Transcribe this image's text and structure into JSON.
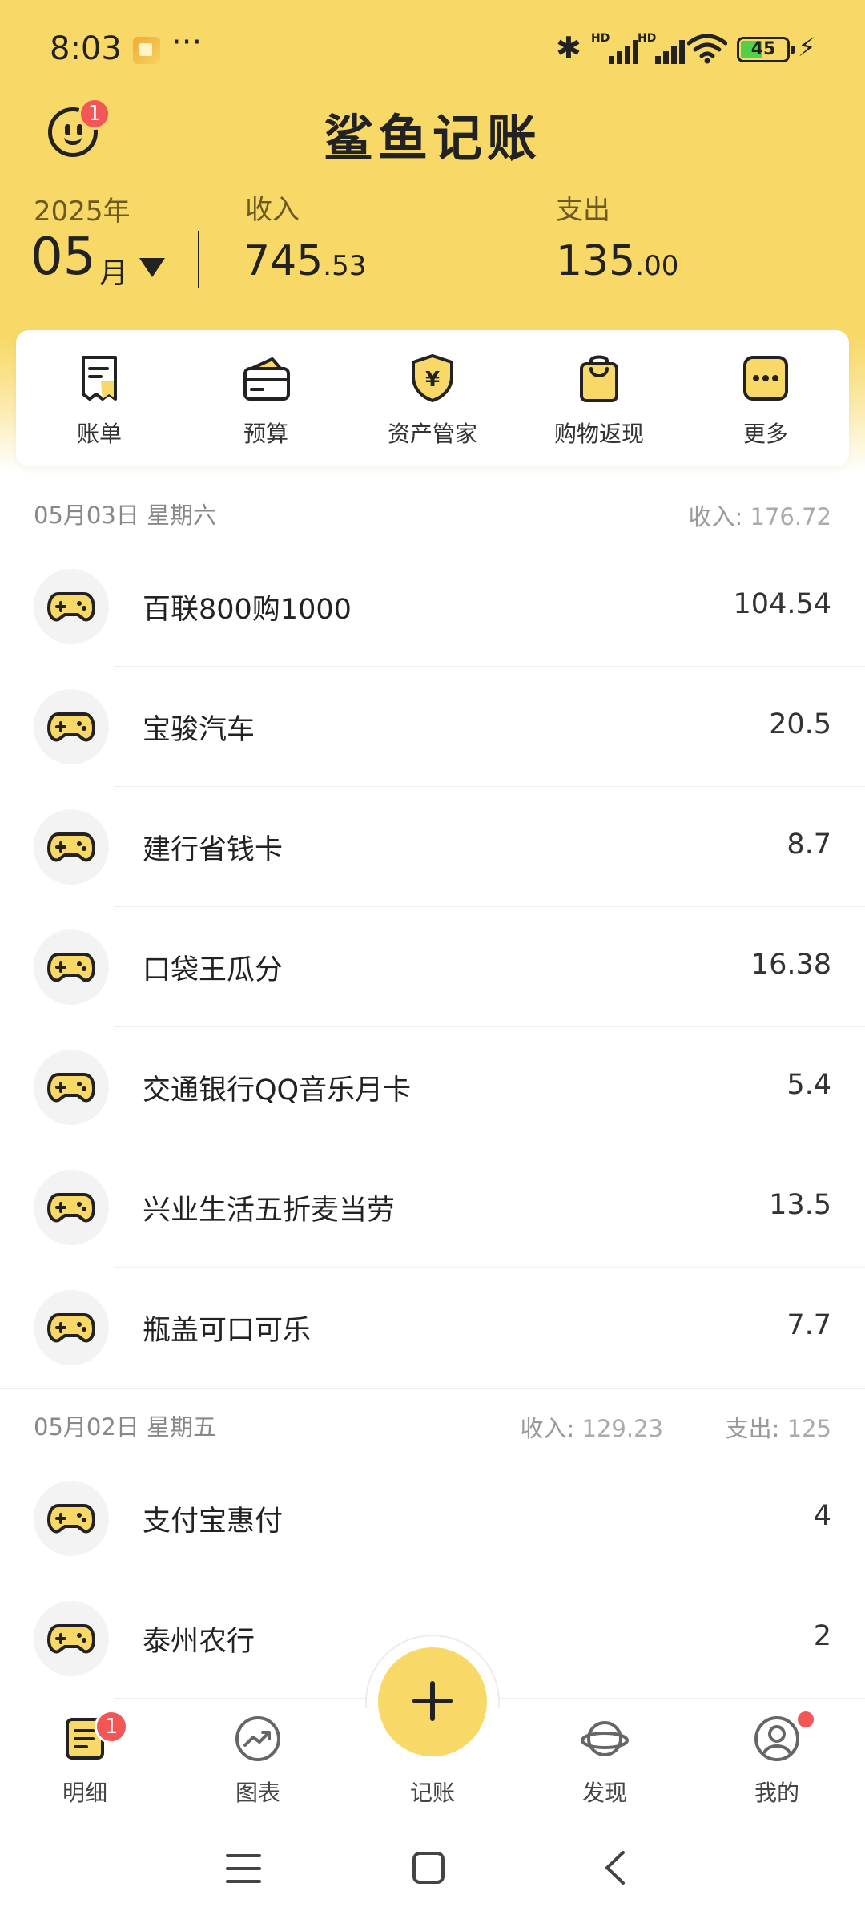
{
  "status_bar": {
    "time": "8:03",
    "more": "···",
    "battery": "45"
  },
  "header": {
    "title": "鲨鱼记账",
    "notification_count": "1",
    "year": "2025年",
    "month": "05",
    "month_unit": "月",
    "income_label": "收入",
    "income_int": "745",
    "income_dec": ".53",
    "expense_label": "支出",
    "expense_int": "135",
    "expense_dec": ".00"
  },
  "quick_menu": [
    {
      "label": "账单",
      "icon": "bill-icon"
    },
    {
      "label": "预算",
      "icon": "budget-wallet-icon"
    },
    {
      "label": "资产管家",
      "icon": "asset-shield-icon"
    },
    {
      "label": "购物返现",
      "icon": "shopping-bag-icon"
    },
    {
      "label": "更多",
      "icon": "more-icon"
    }
  ],
  "groups": [
    {
      "date": "05月03日 星期六",
      "income_label": "收入:",
      "income_value": "176.72",
      "items": [
        {
          "name": "百联800购1000",
          "value": "104.54",
          "icon": "gamepad-icon"
        },
        {
          "name": "宝骏汽车",
          "value": "20.5",
          "icon": "gamepad-icon"
        },
        {
          "name": "建行省钱卡",
          "value": "8.7",
          "icon": "gamepad-icon"
        },
        {
          "name": "口袋王瓜分",
          "value": "16.38",
          "icon": "gamepad-icon"
        },
        {
          "name": "交通银行QQ音乐月卡",
          "value": "5.4",
          "icon": "gamepad-icon"
        },
        {
          "name": "兴业生活五折麦当劳",
          "value": "13.5",
          "icon": "gamepad-icon"
        },
        {
          "name": "瓶盖可口可乐",
          "value": "7.7",
          "icon": "gamepad-icon"
        }
      ]
    },
    {
      "date": "05月02日 星期五",
      "income_label": "收入:",
      "income_value": "129.23",
      "expense_label": "支出:",
      "expense_value": "125",
      "items": [
        {
          "name": "支付宝惠付",
          "value": "4",
          "icon": "gamepad-icon"
        },
        {
          "name": "泰州农行",
          "value": "2",
          "icon": "gamepad-icon"
        }
      ]
    }
  ],
  "bottom_nav": {
    "detail": "明细",
    "detail_badge": "1",
    "charts": "图表",
    "record": "记账",
    "discover": "发现",
    "mine": "我的"
  },
  "colors": {
    "brand_yellow": "#f8d866",
    "badge_red": "#f25656"
  }
}
